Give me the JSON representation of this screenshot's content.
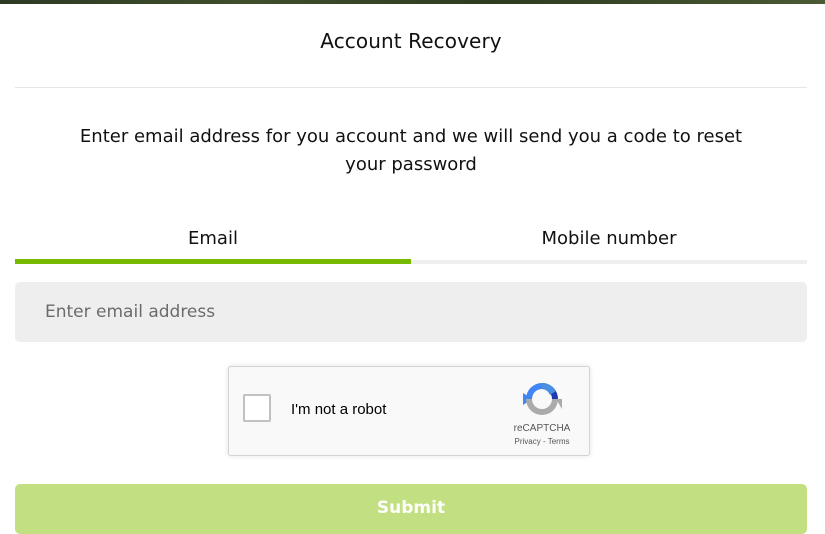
{
  "header": {
    "title": "Account Recovery"
  },
  "instructions": "Enter email address for you account and we will send you a code to reset your password",
  "tabs": [
    {
      "label": "Email",
      "active": true
    },
    {
      "label": "Mobile number",
      "active": false
    }
  ],
  "email_input": {
    "placeholder": "Enter email address",
    "value": ""
  },
  "recaptcha": {
    "label": "I'm not a robot",
    "brand": "reCAPTCHA",
    "privacy_link": "Privacy",
    "separator": "-",
    "terms_link": "Terms",
    "checked": false
  },
  "submit": {
    "label": "Submit"
  },
  "colors": {
    "accent": "#76b900",
    "submit_disabled": "#c2df82",
    "input_bg": "#eeeeee"
  }
}
